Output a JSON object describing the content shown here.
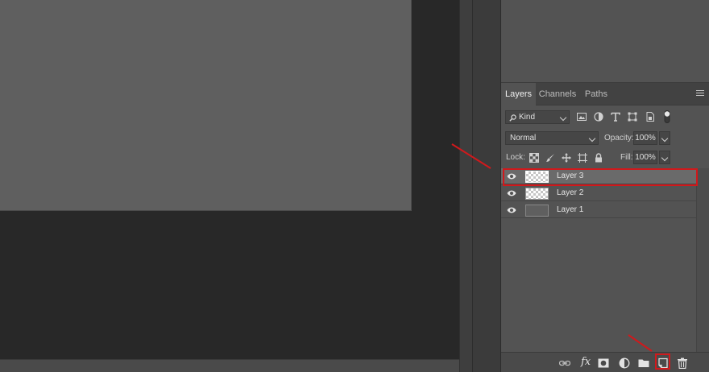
{
  "panel": {
    "tabs": [
      {
        "label": "Layers",
        "active": true
      },
      {
        "label": "Channels",
        "active": false
      },
      {
        "label": "Paths",
        "active": false
      }
    ],
    "menu_icon": "hamburger-menu-icon"
  },
  "filter": {
    "kind_label": "Kind",
    "icons": [
      "image-filter-icon",
      "adjustment-filter-icon",
      "type-filter-icon",
      "shape-filter-icon",
      "smart-object-filter-icon",
      "filter-toggle-icon"
    ]
  },
  "blend": {
    "mode": "Normal",
    "opacity_label": "Opacity:",
    "opacity_value": "100%"
  },
  "lock": {
    "label": "Lock:",
    "icons": [
      "lock-transparent-icon",
      "lock-image-icon",
      "lock-position-icon",
      "lock-artboard-icon",
      "lock-all-icon"
    ],
    "fill_label": "Fill:",
    "fill_value": "100%"
  },
  "layers": [
    {
      "name": "Layer 3",
      "selected": true,
      "thumb": "transparent"
    },
    {
      "name": "Layer 2",
      "selected": false,
      "thumb": "transparent"
    },
    {
      "name": "Layer 1",
      "selected": false,
      "thumb": "solid"
    }
  ],
  "bottom_bar": {
    "icons": [
      "link-layers-icon",
      "fx-icon",
      "add-mask-icon",
      "adjustment-layer-icon",
      "new-group-icon",
      "new-layer-icon",
      "delete-layer-icon"
    ],
    "fx_label": "fx"
  },
  "colors": {
    "annotation": "#d0191c",
    "panel_bg": "#535353",
    "canvas_bg": "#5f5f5f",
    "workspace_bg": "#282828"
  }
}
